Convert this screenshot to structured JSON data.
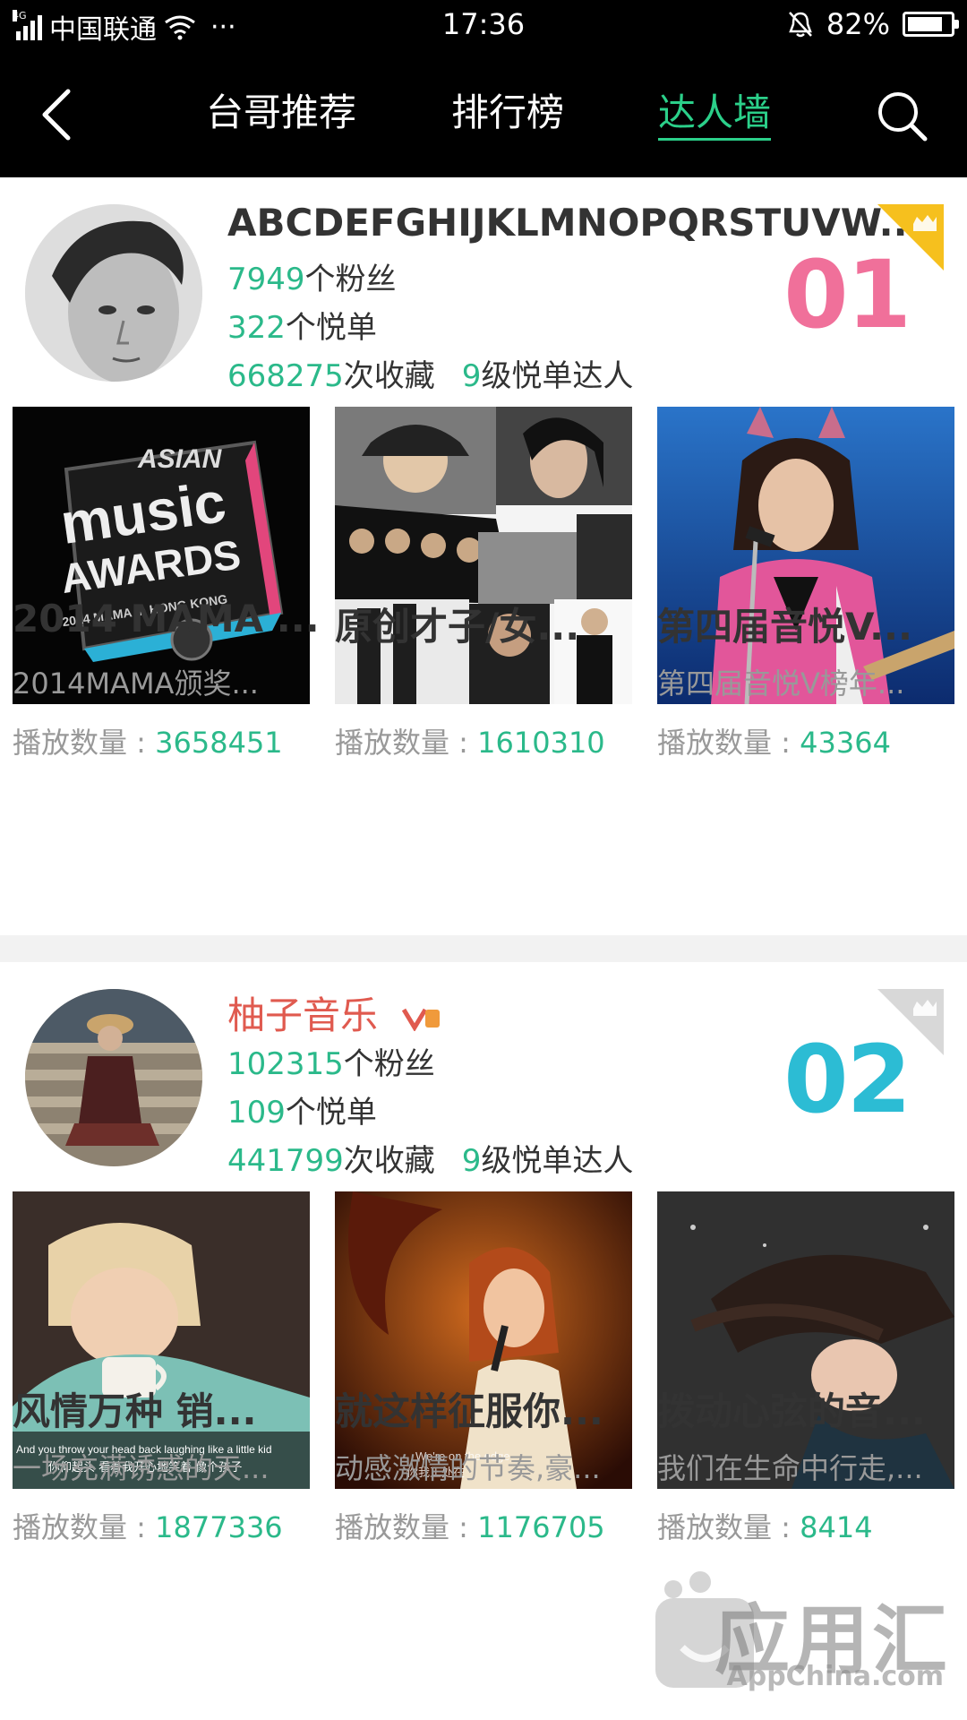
{
  "status_bar": {
    "carrier": "中国联通",
    "network": "4G",
    "time": "17:36",
    "battery": "82%",
    "battery_level": 0.82,
    "more": "···"
  },
  "nav": {
    "tabs": [
      {
        "label": "台哥推荐",
        "active": false
      },
      {
        "label": "排行榜",
        "active": false
      },
      {
        "label": "达人墙",
        "active": true
      }
    ],
    "active_color": "#2bd08a"
  },
  "cards": [
    {
      "name": "ABCDEFGHIJKLMNOPQRSTUVW...",
      "fans": "7949",
      "fans_suffix": "个粉丝",
      "playlists": "322",
      "playlists_suffix": "个悦单",
      "favorites": "668275",
      "favorites_suffix": "次收藏",
      "level": "9",
      "level_suffix": "级悦单达人",
      "rank": "01",
      "rank_color": "#f0709a",
      "items": [
        {
          "title": "2014 MAMA ...",
          "desc": "2014MAMA颁奖...",
          "play_label": "播放数量 : ",
          "plays": "3658451",
          "thumb_text": "MUSIC AWARDS",
          "thumb_sub": "2014 MAMA in HONG KONG"
        },
        {
          "title": "原创才子/女...",
          "desc": "",
          "play_label": "播放数量 : ",
          "plays": "1610310"
        },
        {
          "title": "第四届音悦V...",
          "desc": "第四届音悦V榜年...",
          "play_label": "播放数量 : ",
          "plays": "43364"
        }
      ]
    },
    {
      "name": "柚子音乐",
      "fans": "102315",
      "fans_suffix": "个粉丝",
      "playlists": "109",
      "playlists_suffix": "个悦单",
      "favorites": "441799",
      "favorites_suffix": "次收藏",
      "level": "9",
      "level_suffix": "级悦单达人",
      "rank": "02",
      "rank_color": "#2cbcd4",
      "items": [
        {
          "title": "风情万种 销...",
          "desc": "一场充满诱惑的天...",
          "play_label": "播放数量 : ",
          "plays": "1877336",
          "subtitle_en": "And you throw your head back laughing like a little kid",
          "subtitle_cn": "你仰起头 看着我开心地笑着 像个孩子"
        },
        {
          "title": "就这样征服你...",
          "desc": "动感激情的节奏,豪...",
          "play_label": "播放数量 : ",
          "plays": "1176705",
          "subtitle_en": "We're on the edge",
          "subtitle_cn": "你我正处在"
        },
        {
          "title": "拨动心弦的音...",
          "desc": "我们在生命中行走,...",
          "play_label": "播放数量 : ",
          "plays": "8414"
        }
      ]
    }
  ],
  "watermark": {
    "text": "应用汇",
    "sub": "AppChina.com"
  }
}
